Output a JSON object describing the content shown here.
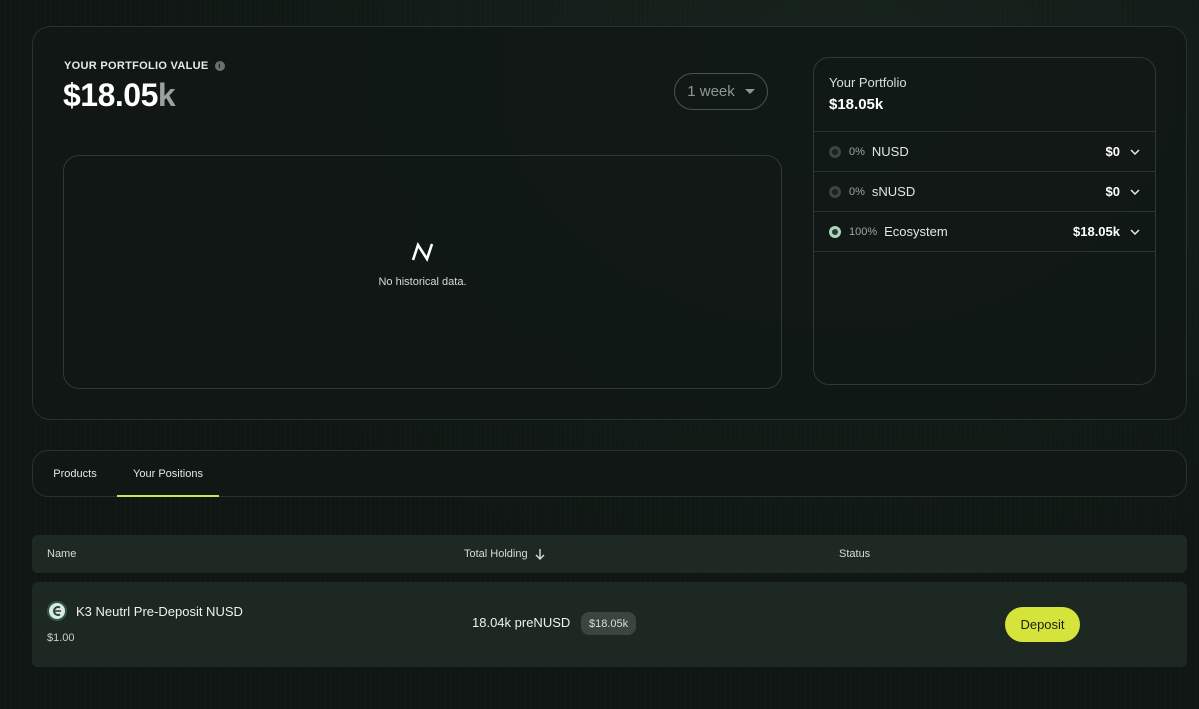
{
  "portfolio_value": {
    "label": "YOUR PORTFOLIO VALUE",
    "value_main": "$18.05",
    "value_suffix": "k"
  },
  "period_select": {
    "selected": "1 week"
  },
  "chart": {
    "empty_message": "No historical data."
  },
  "portfolio_panel": {
    "title": "Your Portfolio",
    "total": "$18.05k",
    "rows": [
      {
        "pct": "0%",
        "asset": "NUSD",
        "amount": "$0"
      },
      {
        "pct": "0%",
        "asset": "sNUSD",
        "amount": "$0"
      },
      {
        "pct": "100%",
        "asset": "Ecosystem",
        "amount": "$18.05k"
      }
    ]
  },
  "tabs": [
    {
      "label": "Products"
    },
    {
      "label": "Your Positions"
    }
  ],
  "table": {
    "headers": {
      "name": "Name",
      "holding": "Total Holding",
      "status": "Status"
    },
    "rows": [
      {
        "name": "K3 Neutrl Pre-Deposit NUSD",
        "price": "$1.00",
        "holding": "18.04k preNUSD",
        "holding_usd": "$18.05k",
        "action": "Deposit"
      }
    ]
  },
  "colors": {
    "accent": "#d6e33a",
    "tab_underline": "#d4e157",
    "active_dot": "#a8d8b8"
  },
  "icons": [
    "info-icon",
    "neutrl-logo-icon",
    "chevron-down-icon",
    "arrow-down-icon",
    "token-icon"
  ]
}
